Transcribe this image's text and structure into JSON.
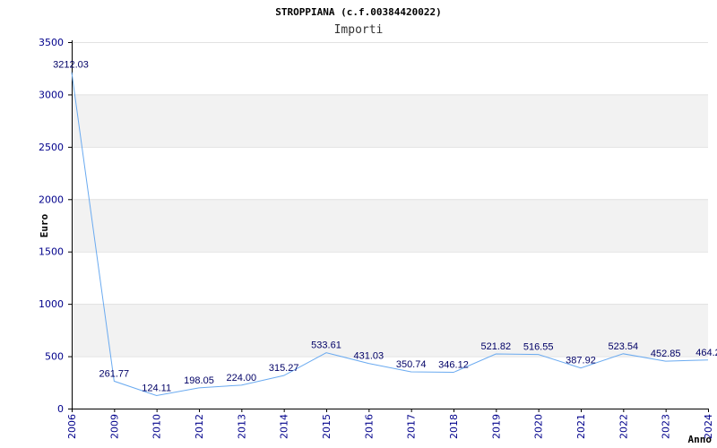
{
  "chart_data": {
    "type": "line",
    "title": "STROPPIANA (c.f.00384420022)",
    "subtitle": "Importi",
    "xlabel": "Anno",
    "ylabel": "Euro",
    "categories": [
      "2006",
      "2009",
      "2010",
      "2012",
      "2013",
      "2014",
      "2015",
      "2016",
      "2017",
      "2018",
      "2019",
      "2020",
      "2021",
      "2022",
      "2023",
      "2024"
    ],
    "series": [
      {
        "values": [
          3212.03,
          261.77,
          124.11,
          198.05,
          224.0,
          315.27,
          533.61,
          431.03,
          350.74,
          346.12,
          521.82,
          516.55,
          387.92,
          523.54,
          452.85,
          464.2
        ],
        "labels": [
          "3212.03",
          "261.77",
          "124.11",
          "198.05",
          "224.00",
          "315.27",
          "533.61",
          "431.03",
          "350.74",
          "346.12",
          "521.82",
          "516.55",
          "387.92",
          "523.54",
          "452.85",
          "464.2"
        ]
      }
    ],
    "ylim": [
      0,
      3500
    ],
    "yticks": [
      0,
      500,
      1000,
      1500,
      2000,
      2500,
      3000,
      3500
    ],
    "grid": true,
    "colors": {
      "line": "#6aaaf0",
      "band": "#f2f2f2",
      "axis": "#000000",
      "tick_text": "#00008b"
    }
  }
}
